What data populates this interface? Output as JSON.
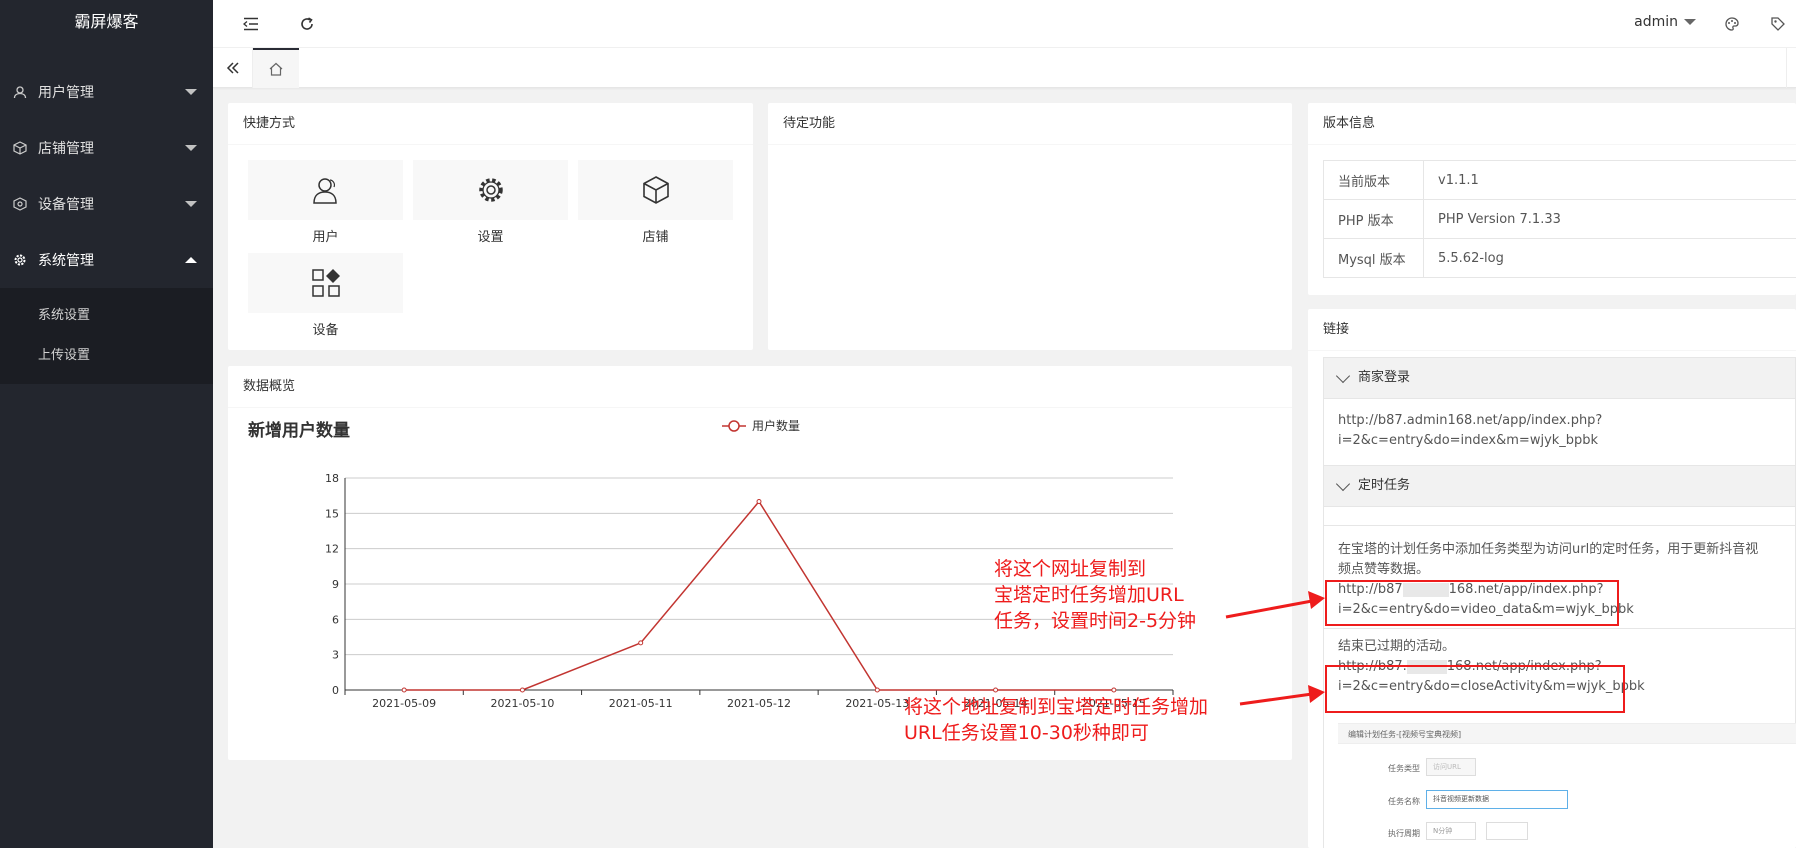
{
  "app": {
    "title": "霸屏爆客"
  },
  "sidebar": {
    "items": [
      {
        "label": "用户管理",
        "icon": "user-icon"
      },
      {
        "label": "店铺管理",
        "icon": "cube-icon"
      },
      {
        "label": "设备管理",
        "icon": "settings-icon"
      },
      {
        "label": "系统管理",
        "icon": "gear-icon",
        "open": true
      }
    ],
    "subitems": [
      {
        "label": "系统设置"
      },
      {
        "label": "上传设置"
      }
    ]
  },
  "header": {
    "user": "admin"
  },
  "shortcuts": {
    "title": "快捷方式",
    "items": [
      {
        "label": "用户",
        "icon": "user-icon"
      },
      {
        "label": "设置",
        "icon": "gear-icon"
      },
      {
        "label": "店铺",
        "icon": "cube-icon"
      },
      {
        "label": "设备",
        "icon": "apps-icon"
      }
    ]
  },
  "pending": {
    "title": "待定功能"
  },
  "version": {
    "title": "版本信息",
    "rows": [
      {
        "key": "当前版本",
        "value": "v1.1.1"
      },
      {
        "key": "PHP 版本",
        "value": "PHP Version 7.1.33"
      },
      {
        "key": "Mysql 版本",
        "value": "5.5.62-log"
      }
    ]
  },
  "links": {
    "title": "链接",
    "merchant": {
      "title": "商家登录",
      "url_line1": "http://b87.admin168.net/app/index.php?",
      "url_line2": "i=2&c=entry&do=index&m=wjyk_bpbk"
    },
    "cron": {
      "title": "定时任务",
      "desc_line1": "在宝塔的计划任务中添加任务类型为访问url的定时任务，用于更新抖音视",
      "desc_line2": "频点赞等数据。",
      "url1_a": "http://b87",
      "url1_b": "168.net/app/index.php?",
      "url1_line2": "i=2&c=entry&do=video_data&m=wjyk_bpbk",
      "desc2": "结束已过期的活动。",
      "url2_a": "http://b87.",
      "url2_b": "168.net/app/index.php?",
      "url2_line2": "i=2&c=entry&do=closeActivity&m=wjyk_bpbk"
    },
    "mini_form": {
      "title": "编辑计划任务-[视频号宝典视频]",
      "type_label": "任务类型",
      "type_value": "访问URL",
      "name_label": "任务名称",
      "name_value": "抖音视频更新数据",
      "period_label": "执行周期",
      "period_value": "N分钟"
    }
  },
  "overview": {
    "title": "数据概览"
  },
  "chart_data": {
    "type": "line",
    "title": "新增用户数量",
    "legend": "用户数量",
    "legend_position": "top-center",
    "categories": [
      "2021-05-09",
      "2021-05-10",
      "2021-05-11",
      "2021-05-12",
      "2021-05-13",
      "2021-05-14",
      "2021-05-15"
    ],
    "series": [
      {
        "name": "用户数量",
        "values": [
          0,
          0,
          4,
          16,
          0,
          0,
          0
        ]
      }
    ],
    "ylim": [
      0,
      18
    ],
    "yticks": [
      "0",
      "3",
      "6",
      "9",
      "12",
      "15",
      "18"
    ],
    "grid": true,
    "color": "#c23531"
  },
  "annotations": {
    "a1_line1": "将这个网址复制到",
    "a1_line2": "宝塔定时任务增加URL",
    "a1_line3": "任务，设置时间2-5分钟",
    "a2_line1": "将这个地址复制到宝塔定时任务增加",
    "a2_line2": "URL任务设置10-30秒种即可"
  }
}
